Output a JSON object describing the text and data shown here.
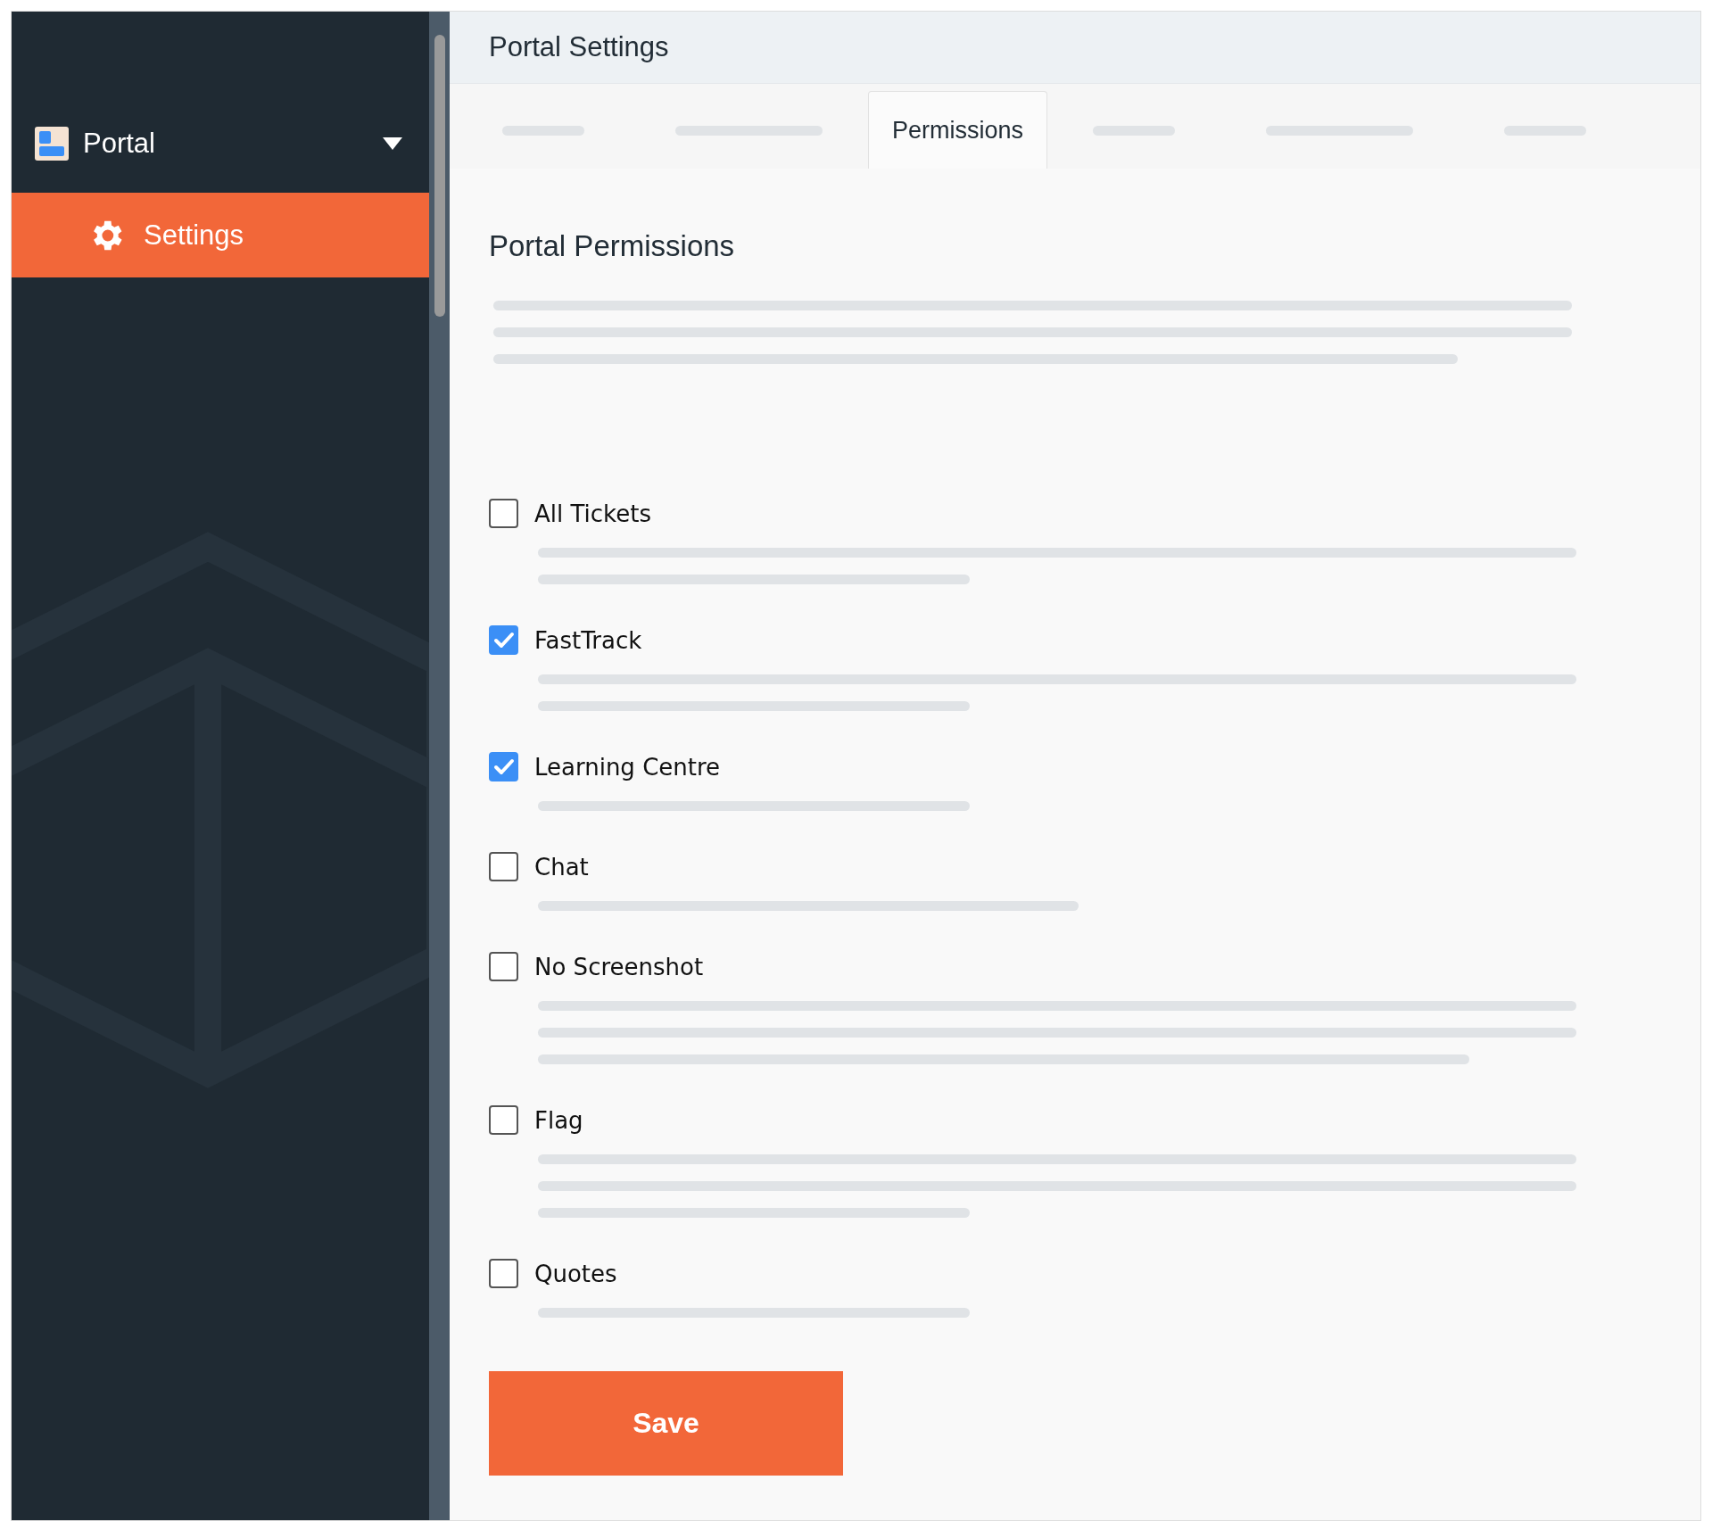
{
  "sidebar": {
    "app": {
      "label": "Portal",
      "expanded": true
    },
    "items": [
      {
        "label": "Settings",
        "selected": true
      }
    ]
  },
  "header": {
    "title": "Portal Settings"
  },
  "tabs": [
    {
      "selected": false
    },
    {
      "selected": false
    },
    {
      "label": "Permissions",
      "selected": true
    },
    {
      "selected": false
    },
    {
      "selected": false
    },
    {
      "selected": false
    }
  ],
  "section": {
    "title": "Portal Permissions"
  },
  "permissions": [
    {
      "label": "All Tickets",
      "checked": false
    },
    {
      "label": "FastTrack",
      "checked": true
    },
    {
      "label": "Learning Centre",
      "checked": true
    },
    {
      "label": "Chat",
      "checked": false
    },
    {
      "label": "No Screenshot",
      "checked": false
    },
    {
      "label": "Flag",
      "checked": false
    },
    {
      "label": "Quotes",
      "checked": false
    }
  ],
  "save_button": "Save"
}
